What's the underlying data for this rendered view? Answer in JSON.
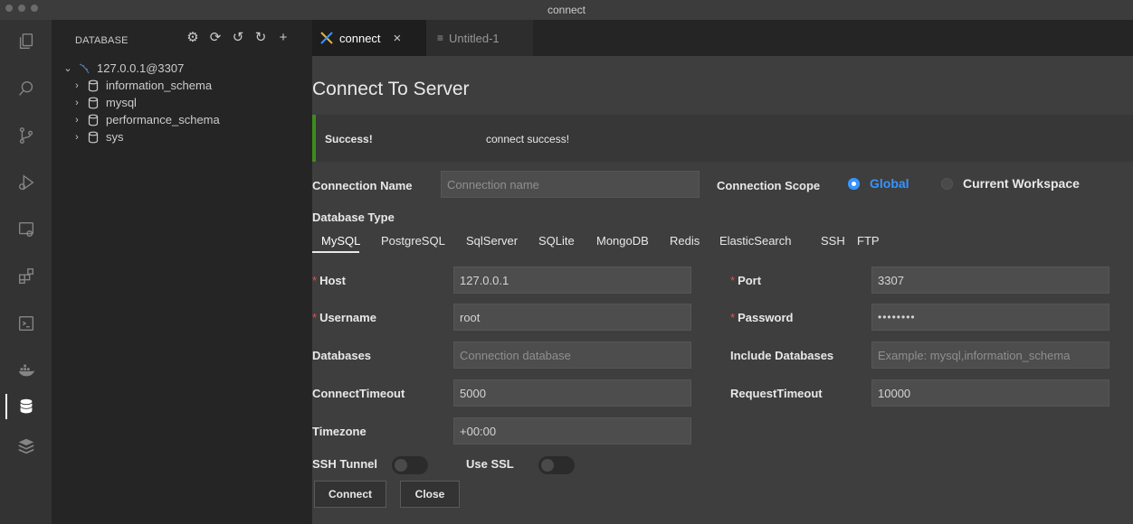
{
  "window": {
    "title": "connect"
  },
  "activity_bar": {
    "items": [
      {
        "icon": "files-icon"
      },
      {
        "icon": "search-icon"
      },
      {
        "icon": "source-control-icon"
      },
      {
        "icon": "run-debug-icon"
      },
      {
        "icon": "remote-explorer-icon"
      },
      {
        "icon": "extensions-icon"
      },
      {
        "icon": "terminal-icon"
      },
      {
        "icon": "docker-icon"
      },
      {
        "icon": "database-icon",
        "active": true
      },
      {
        "icon": "nosql-icon"
      }
    ]
  },
  "sidebar": {
    "title": "DATABASE",
    "actions": [
      "settings-icon",
      "refresh-icon",
      "history-icon",
      "reload-icon",
      "add-icon"
    ],
    "connection": "127.0.0.1@3307",
    "databases": [
      "information_schema",
      "mysql",
      "performance_schema",
      "sys"
    ]
  },
  "tabs": [
    {
      "label": "connect",
      "active": true
    },
    {
      "label": "Untitled-1",
      "active": false
    }
  ],
  "form": {
    "heading": "Connect To Server",
    "alert": {
      "title": "Success!",
      "message": "connect success!",
      "color": "#3f8a1c"
    },
    "connection_name": {
      "label": "Connection Name",
      "placeholder": "Connection name"
    },
    "scope": {
      "label": "Connection Scope",
      "options": [
        "Global",
        "Current Workspace"
      ],
      "selected": "Global"
    },
    "database_type": {
      "label": "Database Type",
      "options": [
        "MySQL",
        "PostgreSQL",
        "SqlServer",
        "SQLite",
        "MongoDB",
        "Redis",
        "ElasticSearch",
        "SSH",
        "FTP"
      ],
      "selected": "MySQL"
    },
    "host": {
      "label": "Host",
      "value": "127.0.0.1"
    },
    "port": {
      "label": "Port",
      "value": "3307"
    },
    "username": {
      "label": "Username",
      "value": "root"
    },
    "password": {
      "label": "Password",
      "value": "••••••••"
    },
    "databases": {
      "label": "Databases",
      "placeholder": "Connection database"
    },
    "include_databases": {
      "label": "Include Databases",
      "placeholder": "Example: mysql,information_schema"
    },
    "connect_timeout": {
      "label": "ConnectTimeout",
      "value": "5000"
    },
    "request_timeout": {
      "label": "RequestTimeout",
      "value": "10000"
    },
    "timezone": {
      "label": "Timezone",
      "value": "+00:00"
    },
    "ssh_tunnel": {
      "label": "SSH Tunnel",
      "enabled": false
    },
    "use_ssl": {
      "label": "Use SSL",
      "enabled": false
    },
    "connect_label": "Connect",
    "close_label": "Close",
    "required_mark": "*"
  }
}
